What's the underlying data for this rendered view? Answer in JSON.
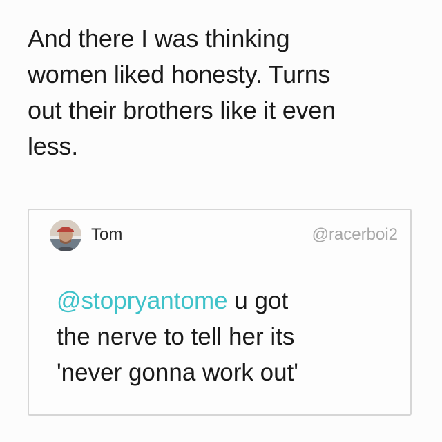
{
  "tweet": {
    "text_lines": [
      "And there I was thinking",
      "women liked honesty. Turns",
      "out their brothers like it even",
      "less."
    ]
  },
  "quoted_tweet": {
    "avatar_icon": "user-avatar-photo",
    "user_name": "Tom",
    "handle": "@racerboi2",
    "mention": "@stopryantome",
    "line1_rest": " u got",
    "line2": "the nerve to tell her its",
    "line3": "'never gonna work out'",
    "mention_color": "#3fc2c9"
  }
}
